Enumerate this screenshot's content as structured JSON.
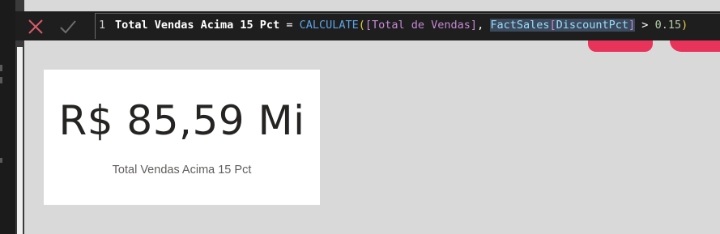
{
  "formula_bar": {
    "line_number": "1",
    "measure_name": "Total Vendas Acima 15 Pct",
    "equals": " = ",
    "function": "CALCULATE",
    "open_paren": "(",
    "measure_ref": "[Total de Vendas]",
    "comma": ", ",
    "table": "FactSales",
    "column_open": "[",
    "column": "DiscountPct",
    "column_close": "]",
    "operator": " > ",
    "number": "0.15",
    "close_paren": ")"
  },
  "card": {
    "value": "R$ 85,59 Mi",
    "label": "Total Vendas Acima 15 Pct"
  },
  "colors": {
    "canvas": "#d9d9d9",
    "formula_bar_bg": "#1e1e1e",
    "accent_shape": "#e8335a",
    "card_bg": "#ffffff"
  },
  "icons": {
    "cancel": "close-icon",
    "commit": "check-icon"
  }
}
